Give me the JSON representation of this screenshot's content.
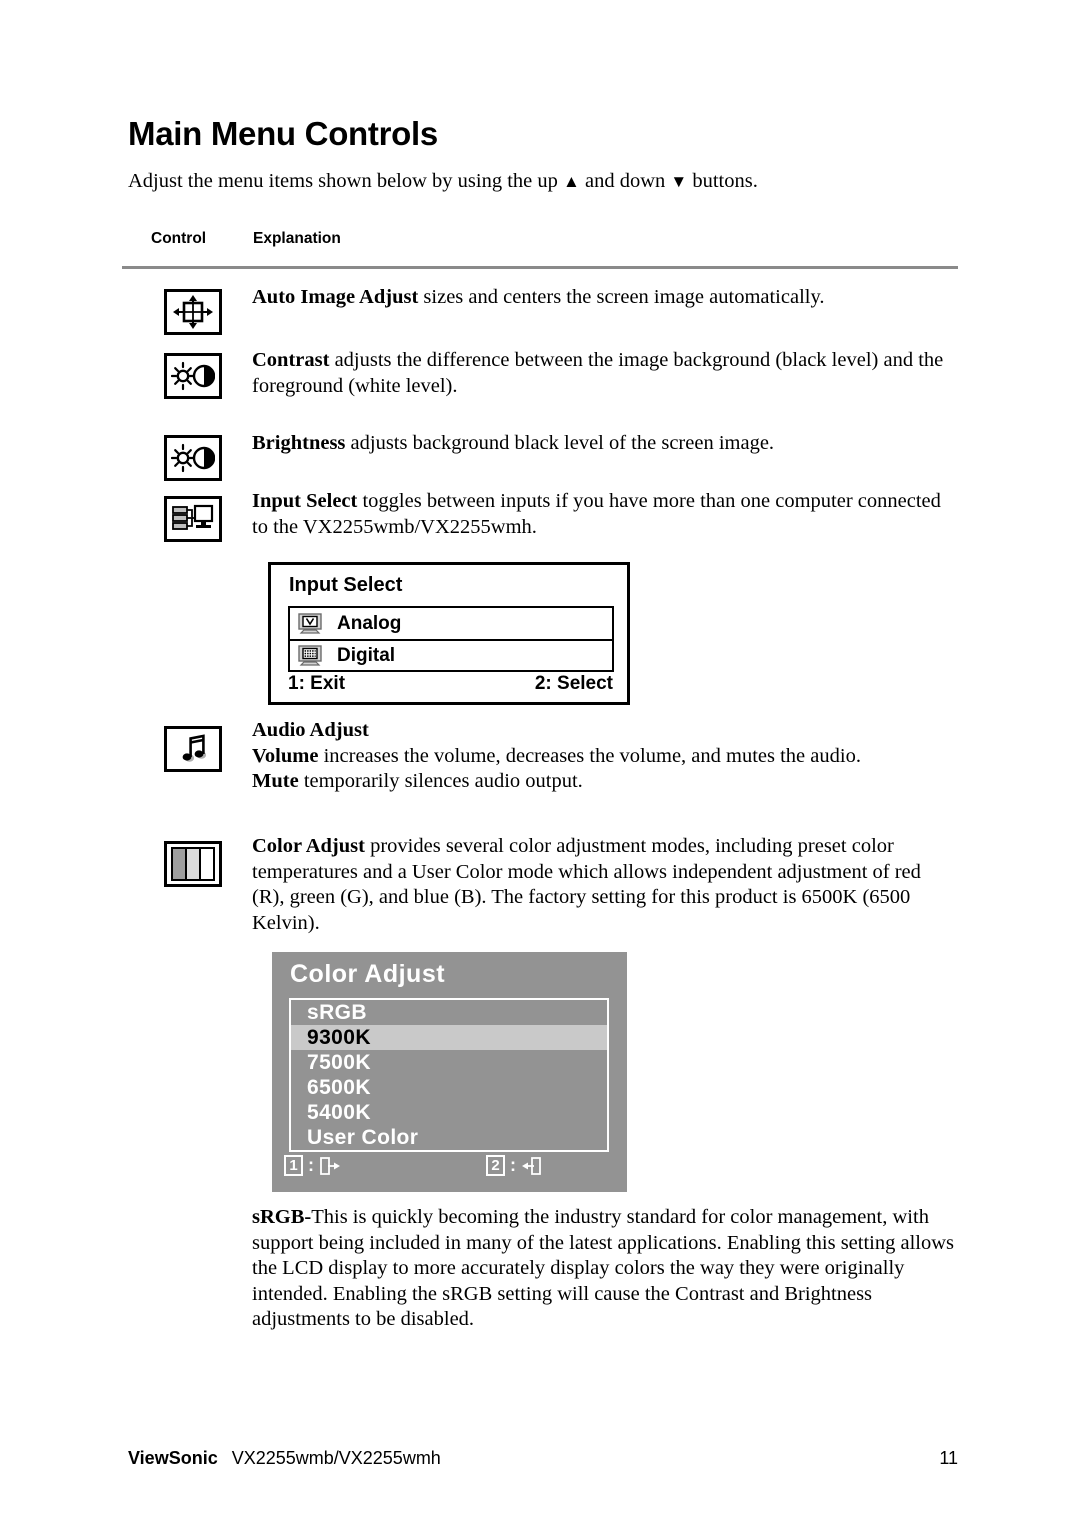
{
  "document": {
    "title": "Main Menu Controls",
    "intro_before": "Adjust the menu items shown below by using the up ",
    "intro_up_glyph": "▲",
    "intro_middle": " and down ",
    "intro_down_glyph": "▼",
    "intro_after": " buttons."
  },
  "table": {
    "header_control": "Control",
    "header_explanation": "Explanation",
    "rows": [
      {
        "icon": "auto-image-adjust-icon",
        "term": "Auto Image Adjust",
        "text": " sizes and centers the screen image automatically."
      },
      {
        "icon": "contrast-icon",
        "term": "Contrast",
        "text": " adjusts the difference between the image background  (black level) and the foreground (white level)."
      },
      {
        "icon": "brightness-icon",
        "term": "Brightness",
        "text": " adjusts background black level of the screen image."
      },
      {
        "icon": "input-select-icon",
        "term": "Input Select",
        "text": " toggles between inputs if you have more than one computer connected to the VX2255wmb/VX2255wmh."
      }
    ],
    "audio": {
      "icon": "music-note-icon",
      "heading": "Audio Adjust",
      "volume_term": "Volume",
      "volume_text": " increases the volume, decreases the volume, and mutes the audio.",
      "mute_term": "Mute",
      "mute_text": " temporarily silences audio output."
    },
    "color": {
      "icon": "color-bars-icon",
      "term": "Color Adjust",
      "text": " provides several color adjustment modes, including preset color temperatures and a User Color mode which allows independent adjustment of red (R), green (G), and blue (B). The factory setting for this product is 6500K (6500 Kelvin)."
    },
    "srgb": {
      "term": "sRGB-",
      "text": "This is quickly becoming the industry standard for color management, with support being included in many of the latest applications. Enabling this setting allows the LCD display to more accurately display colors the way they were originally intended. Enabling the sRGB setting will cause the Contrast and Brightness adjustments to be disabled."
    }
  },
  "osd_input_select": {
    "title": "Input Select",
    "items": [
      {
        "label": "Analog",
        "icon": "analog-monitor-icon"
      },
      {
        "label": "Digital",
        "icon": "digital-monitor-icon"
      }
    ],
    "footer_left": "1: Exit",
    "footer_right": "2: Select",
    "colors": {
      "border": "#000000",
      "background": "#ffffff"
    }
  },
  "osd_color_adjust": {
    "title": "Color Adjust",
    "items": [
      {
        "label": "sRGB",
        "selected": false
      },
      {
        "label": "9300K",
        "selected": true
      },
      {
        "label": "7500K",
        "selected": false
      },
      {
        "label": "6500K",
        "selected": false
      },
      {
        "label": "5400K",
        "selected": false
      },
      {
        "label": "User Color",
        "selected": false
      }
    ],
    "footer": {
      "key1": "1",
      "key1_sep": ":",
      "key1_icon": "exit-arrow-icon",
      "key2": "2",
      "key2_sep": ":",
      "key2_icon": "enter-arrow-icon"
    },
    "colors": {
      "panel_background": "#939393",
      "selected_row": "#c9c9c9",
      "text": "#ffffff",
      "selected_text": "#000000"
    }
  },
  "footer": {
    "brand": "ViewSonic",
    "model": "VX2255wmb/VX2255wmh",
    "page_number": "11"
  }
}
